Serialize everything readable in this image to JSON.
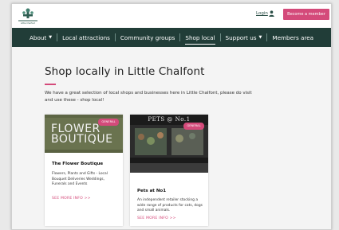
{
  "header": {
    "logo_text": "Little Chalfont",
    "login_label": "Login",
    "become_member_label": "Become a member"
  },
  "nav": {
    "items": [
      {
        "label": "About",
        "has_dropdown": true
      },
      {
        "label": "Local attractions",
        "has_dropdown": false
      },
      {
        "label": "Community groups",
        "has_dropdown": false
      },
      {
        "label": "Shop local",
        "has_dropdown": false,
        "active": true
      },
      {
        "label": "Support us",
        "has_dropdown": true
      },
      {
        "label": "Members area",
        "has_dropdown": false
      }
    ]
  },
  "main": {
    "title": "Shop locally in Little Chalfont",
    "intro": "We have a great selection of local shops and businesses here in Little Chalfont, please do visit and use these - shop local!"
  },
  "cards": [
    {
      "image_text": "FLOWER BOUTIQUE",
      "badge": "GENERAL",
      "title": "The Flower Boutique",
      "description": "Flowers, Plants and Gifts - Local Bouquet Deliveries Weddings, Funerals and Events",
      "more_label": "SEE MORE INFO >>"
    },
    {
      "image_text": "PETS @ No.1",
      "badge": "GENERAL",
      "title": "Pets at No1",
      "description": "An independent retailer stocking a wide range of products for cats, dogs and small animals.",
      "more_label": "SEE MORE INFO >>"
    }
  ],
  "colors": {
    "nav_bg": "#213d38",
    "accent_pink": "#d44a7a",
    "page_bg": "#f4f4f4"
  }
}
